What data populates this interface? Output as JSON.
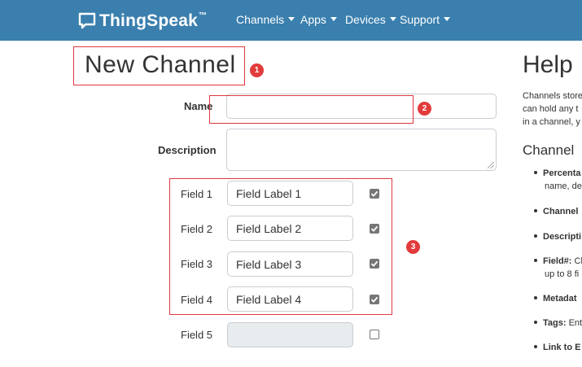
{
  "navbar": {
    "brand": "ThingSpeak",
    "brand_tm": "™",
    "items": [
      {
        "label": "Channels"
      },
      {
        "label": "Apps"
      },
      {
        "label": "Devices"
      },
      {
        "label": "Support"
      }
    ],
    "bg_color": "#3a7fae"
  },
  "page": {
    "title": "New Channel",
    "name_label": "Name",
    "name_value": "",
    "description_label": "Description",
    "description_value": ""
  },
  "fields": [
    {
      "label": "Field 1",
      "value": "Field Label 1",
      "checked": true
    },
    {
      "label": "Field 2",
      "value": "Field Label 2",
      "checked": true
    },
    {
      "label": "Field 3",
      "value": "Field Label 3",
      "checked": true
    },
    {
      "label": "Field 4",
      "value": "Field Label 4",
      "checked": true
    },
    {
      "label": "Field 5",
      "value": "",
      "checked": false
    }
  ],
  "annotations": {
    "badge1": "1",
    "badge2": "2",
    "badge3": "3",
    "color": "#e0383e"
  },
  "help": {
    "title": "Help",
    "line1": "Channels store",
    "line2": "can hold any t",
    "line3": "in a channel, y",
    "subtitle": "Channel",
    "items": [
      {
        "bold": "Percenta",
        "text": "",
        "cont": "name, de"
      },
      {
        "bold": "Channel",
        "text": "",
        "cont": ""
      },
      {
        "bold": "Descripti",
        "text": "",
        "cont": ""
      },
      {
        "bold": "Field#:",
        "text": " Cl",
        "cont": "up to 8 fi"
      },
      {
        "bold": "Metadat",
        "text": "",
        "cont": ""
      },
      {
        "bold": "Tags:",
        "text": " Ent",
        "cont": ""
      },
      {
        "bold": "Link to E",
        "text": "",
        "cont": ""
      }
    ]
  }
}
